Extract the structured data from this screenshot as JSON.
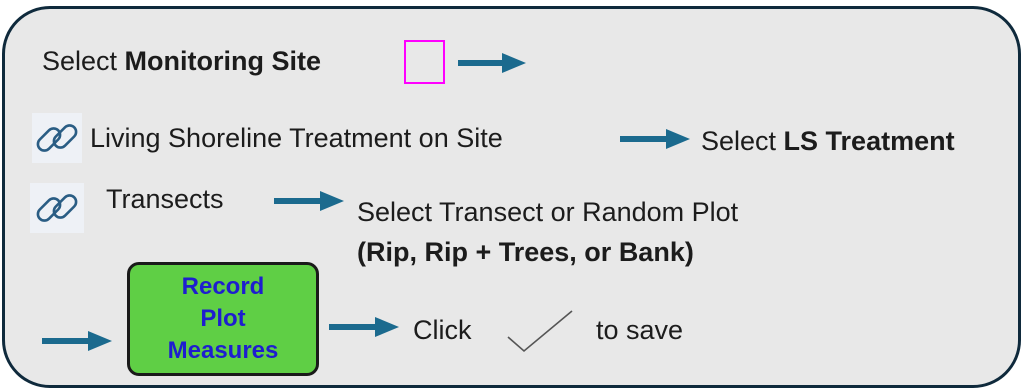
{
  "colors": {
    "panel_bg": "#e8e8e8",
    "panel_border": "#0f2a3c",
    "arrow": "#1b6a8e",
    "highlight_box": "#ff00ff",
    "button_bg": "#5fcf45",
    "button_text": "#1e1ecf"
  },
  "step1": {
    "prefix": "Select ",
    "bold": "Monitoring Site"
  },
  "step2": {
    "icon": "link-icon",
    "label": "Living Shoreline Treatment on Site",
    "result_prefix": "Select ",
    "result_bold": "LS Treatment"
  },
  "step3": {
    "icon": "link-icon",
    "label": "Transects",
    "result": "Select Transect or Random Plot",
    "result_options": "(Rip, Rip + Trees, or Bank)"
  },
  "step4": {
    "button_lines": [
      "Record",
      "Plot",
      "Measures"
    ],
    "click_label": "Click",
    "checkmark_icon": "checkmark-icon",
    "save_label": "to save"
  }
}
